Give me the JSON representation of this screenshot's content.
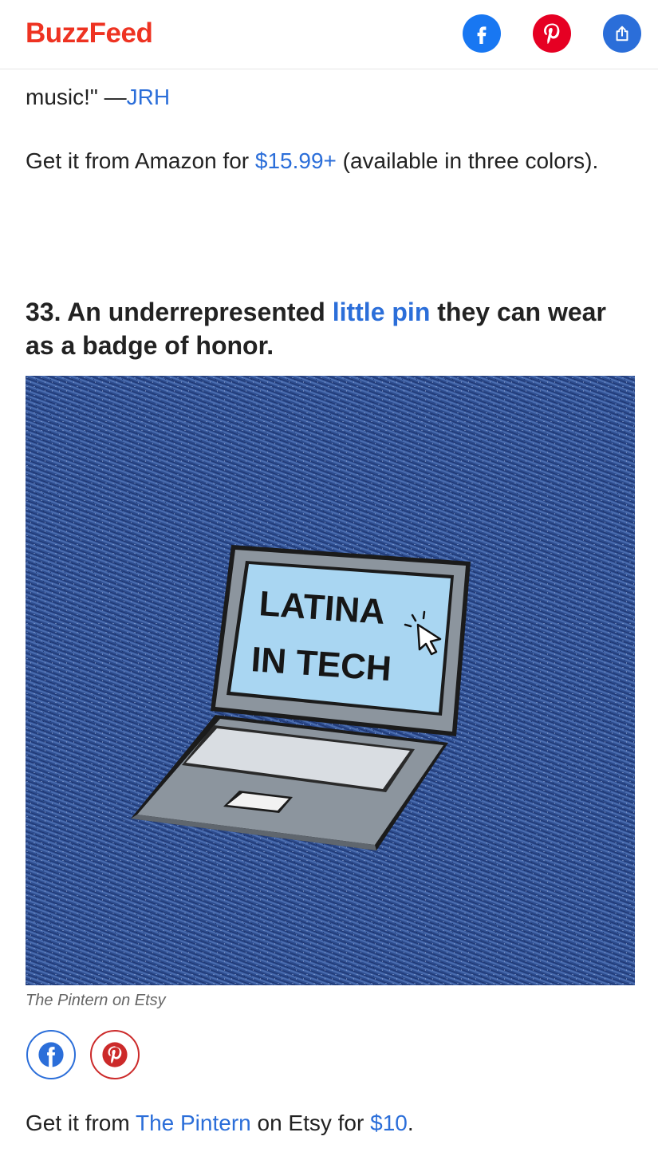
{
  "header": {
    "logo": "BuzzFeed",
    "facebook_icon": "facebook-icon",
    "pinterest_icon": "pinterest-icon",
    "share_icon": "share-icon",
    "colors": {
      "brand": "#ee3322",
      "facebook": "#1877f2",
      "pinterest": "#e60023",
      "share": "#2b6ed9"
    }
  },
  "prev_item": {
    "quote_end": "music!\" —",
    "quote_author": "JRH",
    "buy_prefix": "Get it from Amazon for ",
    "buy_price": "$15.99+",
    "buy_suffix": " (available in three colors)."
  },
  "item": {
    "number_prefix": "33. An underrepresented ",
    "title_link": "little pin",
    "title_suffix": " they can wear as a badge of honor.",
    "image_text_line1": "LATINA",
    "image_text_line2": "IN TECH",
    "image_credit": "The Pintern on Etsy",
    "share_facebook_icon": "facebook-icon",
    "share_pinterest_icon": "pinterest-icon",
    "buy_prefix": "Get it from ",
    "buy_shop": "The Pintern",
    "buy_middle": " on Etsy for ",
    "buy_price": "$10",
    "buy_suffix": "."
  }
}
